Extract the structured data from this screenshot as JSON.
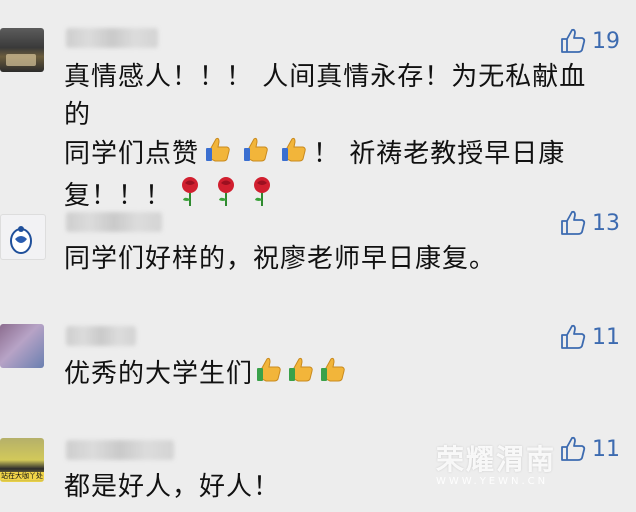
{
  "comments": [
    {
      "text_lines": [
        "真情感人！！！ 人间真情永存！为无私献血的",
        "同学们点赞",
        "！ 祈祷老教授早日康",
        "复！！！"
      ],
      "likes": "19"
    },
    {
      "text": "同学们好样的，祝廖老师早日康复。",
      "likes": "13"
    },
    {
      "text": "优秀的大学生们",
      "likes": "11"
    },
    {
      "text": "都是好人，好人！",
      "likes": "11"
    }
  ],
  "icons": {
    "like": "thumbs-up-outline-icon",
    "thumbs": "thumbs-up-emoji-icon",
    "rose": "rose-emoji-icon"
  },
  "avatar_texts": {
    "a4": "站在大咖丫处"
  },
  "watermark": {
    "title": "荣耀渭南",
    "url": "WWW.YEWN.CN"
  },
  "colors": {
    "like": "#3d6bb0",
    "background": "#ededed"
  }
}
